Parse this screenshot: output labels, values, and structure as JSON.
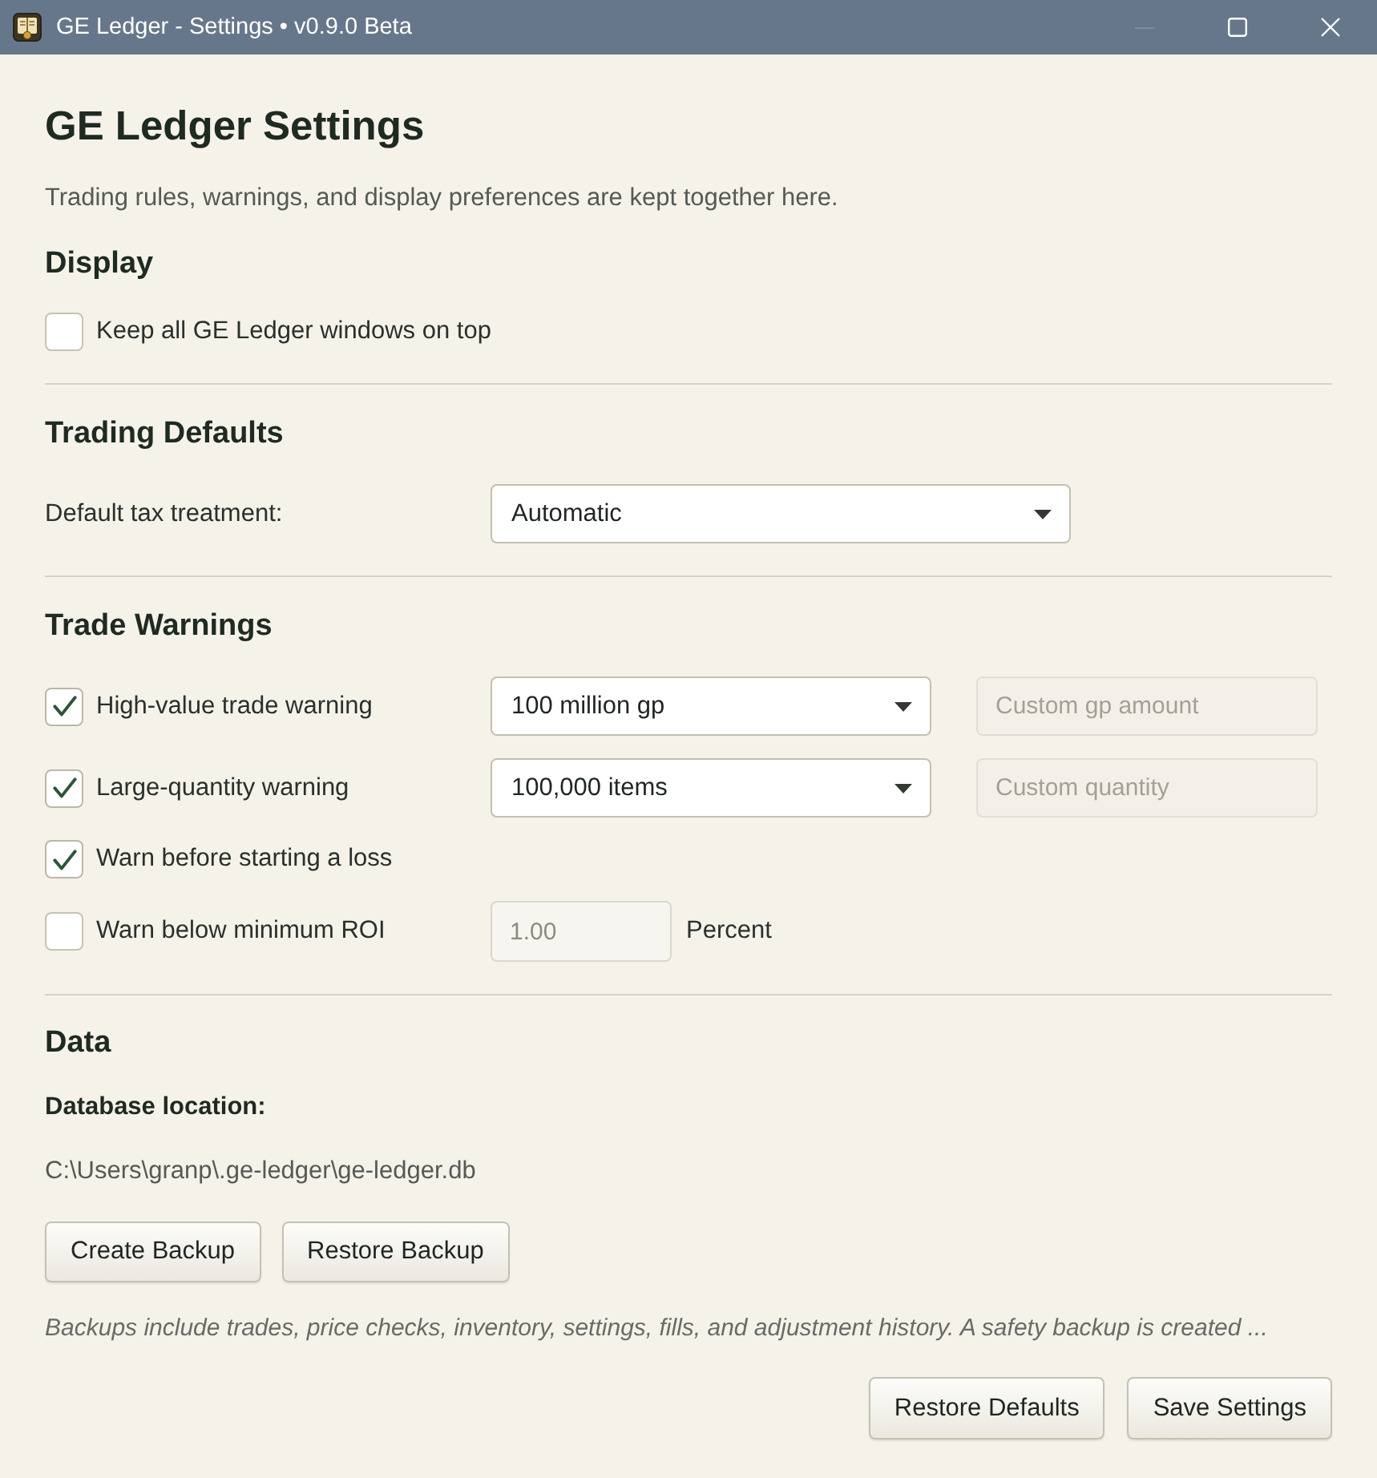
{
  "window": {
    "title": "GE Ledger - Settings • v0.9.0 Beta",
    "controls": [
      {
        "kind": "minimize",
        "disabled": true
      },
      {
        "kind": "maximize",
        "disabled": false
      },
      {
        "kind": "close",
        "disabled": false
      }
    ]
  },
  "header": {
    "title": "GE Ledger Settings",
    "subtitle": "Trading rules, warnings, and display preferences are kept together here."
  },
  "sections": [
    {
      "title": "Display",
      "rows": [
        {
          "kind": "checkbox",
          "label": "Keep all GE Ledger windows on top",
          "checked": false
        }
      ]
    },
    {
      "title": "Trading Defaults",
      "rows": [
        {
          "kind": "select",
          "label": "Default tax treatment:",
          "select": {
            "value": "Automatic"
          }
        }
      ]
    },
    {
      "title": "Trade Warnings",
      "rows": [
        {
          "kind": "checkbox",
          "label": "High-value trade warning",
          "checked": true,
          "select": {
            "value": "100 million gp"
          },
          "field": {
            "placeholder": "Custom gp amount",
            "disabled": true
          }
        },
        {
          "kind": "checkbox",
          "label": "Large-quantity warning",
          "checked": true,
          "select": {
            "value": "100,000 items"
          },
          "field": {
            "placeholder": "Custom quantity",
            "disabled": true
          }
        },
        {
          "kind": "checkbox",
          "label": "Warn before starting a loss",
          "checked": true
        },
        {
          "kind": "checkbox",
          "label": "Warn below minimum ROI",
          "checked": false,
          "number": {
            "value": "1.00",
            "disabled": true,
            "unit": "Percent"
          }
        }
      ]
    }
  ],
  "data": {
    "title": "Data",
    "location_label": "Database location:",
    "path": "C:\\Users\\granp\\.ge-ledger\\ge-ledger.db",
    "buttons": [
      "Create Backup",
      "Restore Backup"
    ],
    "note": "Backups include trades, price checks, inventory, settings, fills, and adjustment history. A safety backup is created ..."
  },
  "footer": {
    "buttons": [
      "Restore Defaults",
      "Save Settings"
    ]
  }
}
